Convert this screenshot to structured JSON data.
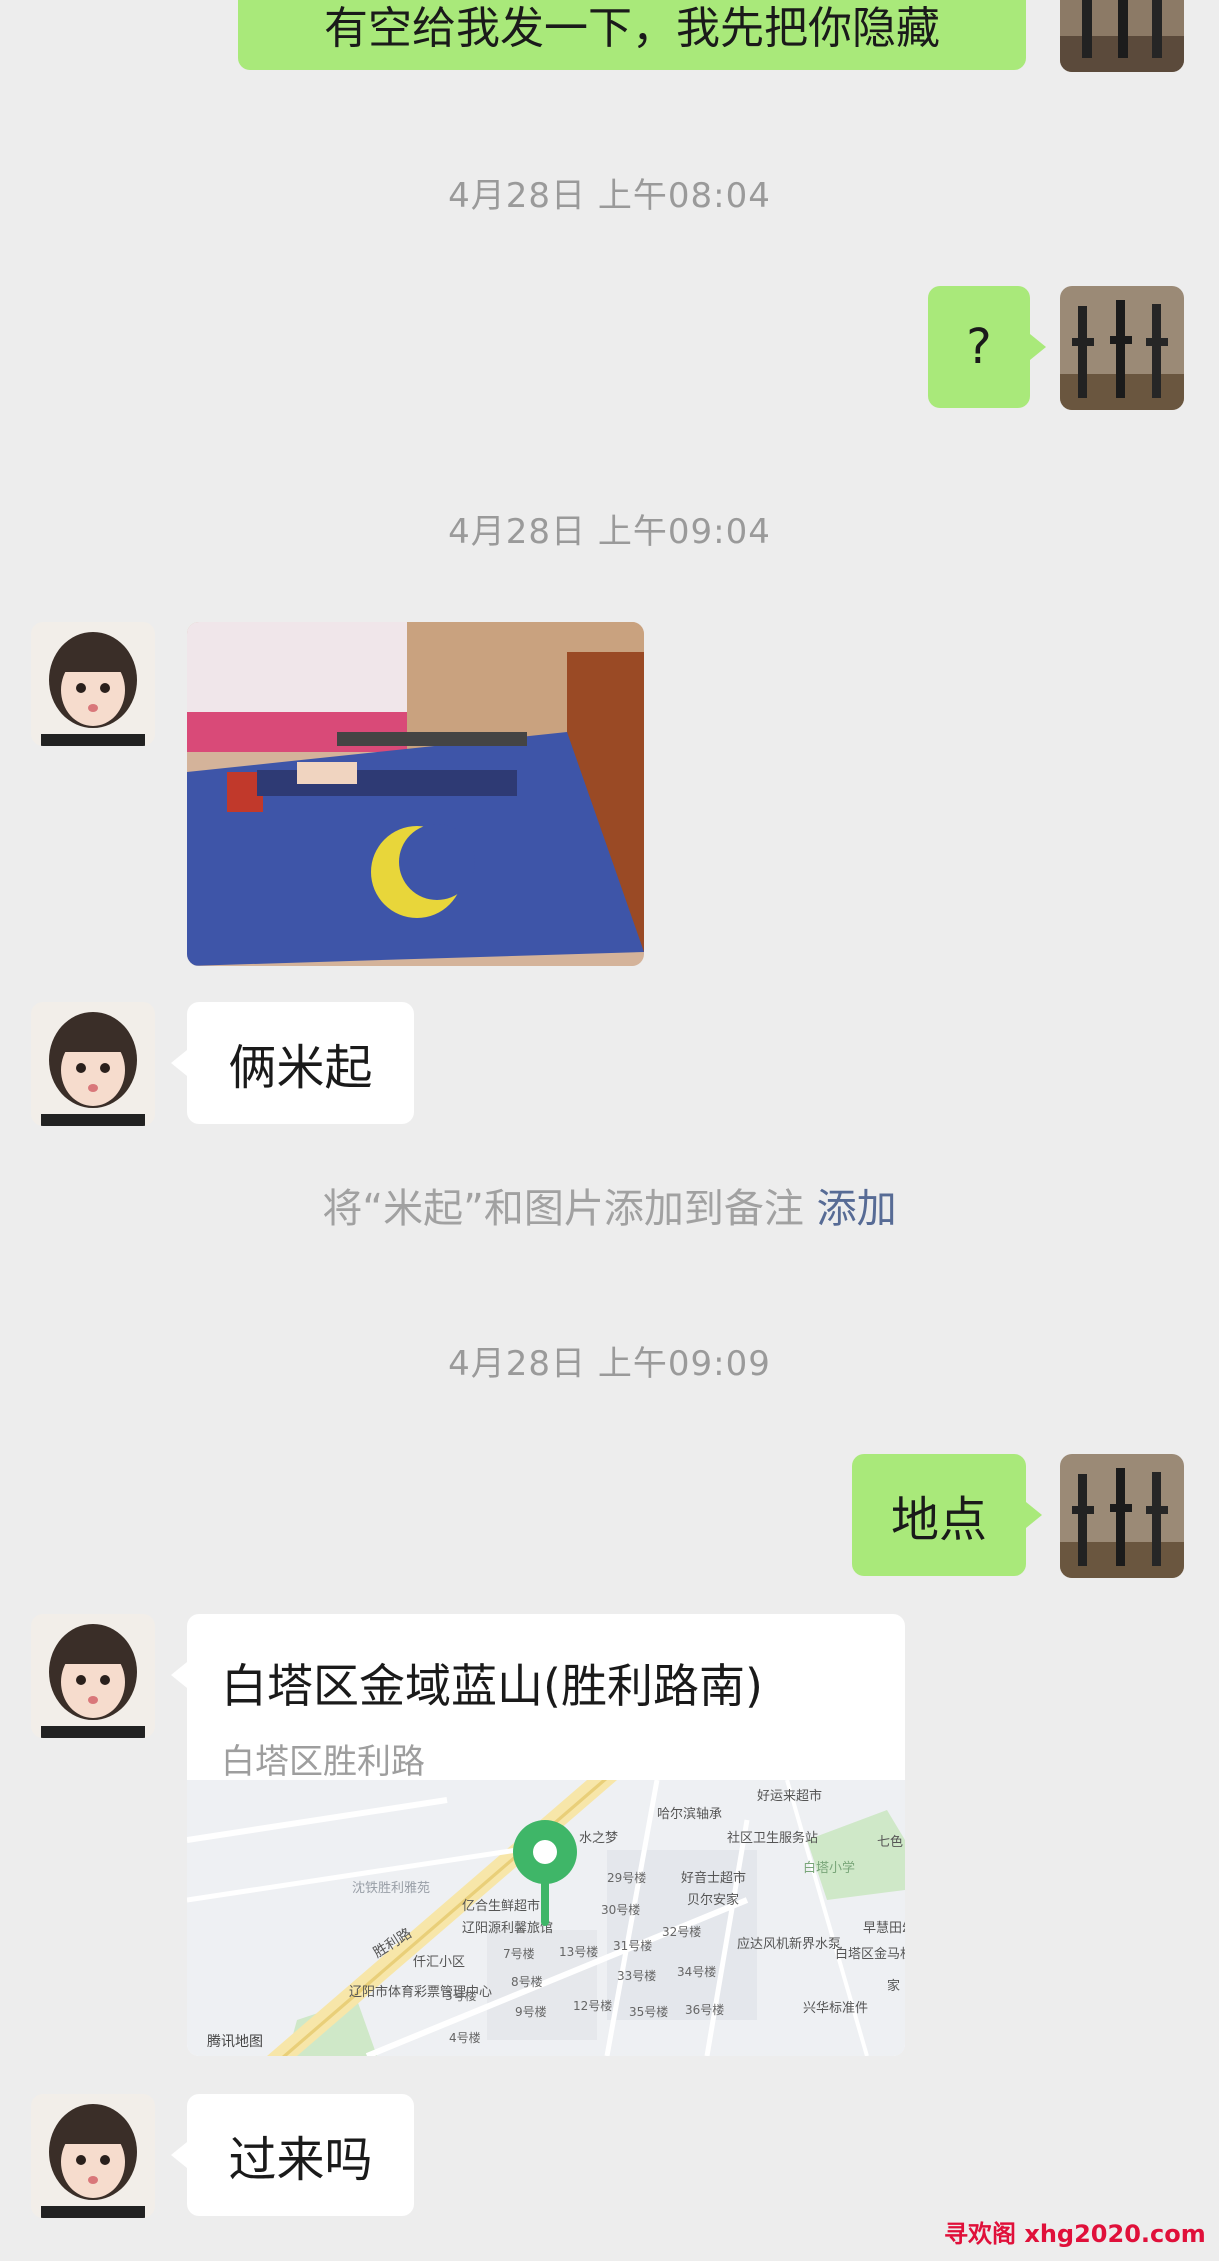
{
  "messages": {
    "top_partial_text": "有空给我发一下，我先把你隐藏",
    "timestamp_1": "4月28日 上午08:04",
    "me_question": "?",
    "timestamp_2": "4月28日 上午09:04",
    "them_text_1": "俩米起",
    "remark_tip": "将“米起”和图片添加到备注",
    "remark_link": "添加",
    "timestamp_3": "4月28日 上午09:09",
    "me_location_word": "地点",
    "them_text_2": "过来吗"
  },
  "location_card": {
    "title": "白塔区金域蓝山(胜利路南)",
    "address": "白塔区胜利路",
    "map_labels": {
      "tencent_map": "腾讯地图",
      "haoyunlai": "好运来超市",
      "haerbin": "哈尔滨轴承",
      "shuizhimeng": "水之梦",
      "shequ": "社区卫生服务站",
      "qise": "七色",
      "baitaxiaoxue": "白塔小学",
      "shenglilu_road": "胜利路",
      "shentie": "沈铁胜利雅苑",
      "yihesheng": "亿合生鲜超市",
      "liaoyangyuan": "辽阳源利馨旅馆",
      "qianhui": "仟汇小区",
      "tiyucaipiao": "辽阳市体育彩票管理中心",
      "b29": "29号楼",
      "b30": "30号楼",
      "b31": "31号楼",
      "b32": "32号楼",
      "b33": "33号楼",
      "b34": "34号楼",
      "b35": "35号楼",
      "b36": "36号楼",
      "b13": "13号楼",
      "b12": "12号楼",
      "b9": "9号楼",
      "b8": "8号楼",
      "b7": "7号楼",
      "b4": "4号楼",
      "b3": "3号楼",
      "haoyinshi": "好音士超市",
      "beiersheng": "贝尔安家",
      "yingda": "应达风机新界水泵",
      "baitaqu": "白塔区金马机电物资处",
      "xinghua": "兴华标准件",
      "zaohuitian": "早慧田幼",
      "jia": "家"
    }
  },
  "watermark": "寻欢阁 xhg2020.com",
  "colors": {
    "me_bubble": "#a9e97a",
    "them_bubble": "#ffffff",
    "background": "#ededed",
    "link": "#576b95",
    "map_pin": "#3fb668"
  }
}
